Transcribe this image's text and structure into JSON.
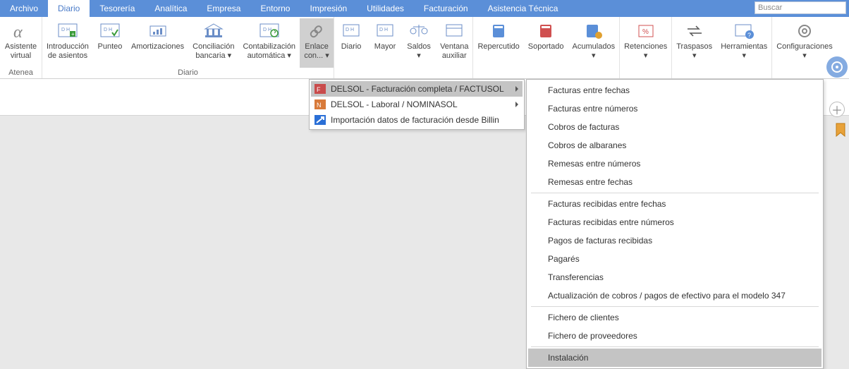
{
  "search_placeholder": "Buscar",
  "tabs": [
    {
      "label": "Archivo"
    },
    {
      "label": "Diario"
    },
    {
      "label": "Tesorería"
    },
    {
      "label": "Analítica"
    },
    {
      "label": "Empresa"
    },
    {
      "label": "Entorno"
    },
    {
      "label": "Impresión"
    },
    {
      "label": "Utilidades"
    },
    {
      "label": "Facturación"
    },
    {
      "label": "Asistencia Técnica"
    }
  ],
  "ribbon": {
    "groups": {
      "atenea": {
        "label": "Atenea",
        "items": {
          "asistente": "Asistente\nvirtual"
        }
      },
      "diario": {
        "label": "Diario",
        "items": {
          "introduccion": "Introducción\nde asientos",
          "punteo": "Punteo",
          "amortizaciones": "Amortizaciones",
          "conciliacion": "Conciliación\nbancaria ▾",
          "contabilizacion": "Contabilización\nautomática ▾",
          "enlace": "Enlace\ncon... ▾"
        }
      },
      "consultas": {
        "diario": "Diario",
        "mayor": "Mayor",
        "saldos": "Saldos\n▾",
        "ventana": "Ventana\nauxiliar"
      },
      "iva": {
        "repercutido": "Repercutido",
        "soportado": "Soportado",
        "acumulados": "Acumulados\n▾"
      },
      "ret": {
        "retenciones": "Retenciones\n▾"
      },
      "utils": {
        "traspasos": "Traspasos\n▾",
        "herramientas": "Herramientas\n▾"
      },
      "config": {
        "configuraciones": "Configuraciones\n▾"
      }
    }
  },
  "submenu1": [
    {
      "label": "DELSOL - Facturación completa / FACTUSOL",
      "icon": "factusol",
      "arrow": true,
      "hovered": true
    },
    {
      "label": "DELSOL - Laboral / NOMINASOL",
      "icon": "nominasol",
      "arrow": true
    },
    {
      "label": "Importación datos de facturación desde Billin",
      "icon": "billin"
    }
  ],
  "submenu2": [
    {
      "label": "Facturas entre fechas"
    },
    {
      "label": "Facturas entre números"
    },
    {
      "label": "Cobros de facturas"
    },
    {
      "label": "Cobros de albaranes"
    },
    {
      "label": "Remesas entre números"
    },
    {
      "label": "Remesas entre fechas"
    },
    {
      "sep": true
    },
    {
      "label": "Facturas recibidas entre fechas"
    },
    {
      "label": "Facturas recibidas entre números"
    },
    {
      "label": "Pagos de facturas recibidas"
    },
    {
      "label": "Pagarés"
    },
    {
      "label": "Transferencias"
    },
    {
      "label": "Actualización de cobros / pagos de efectivo para el modelo 347"
    },
    {
      "sep": true
    },
    {
      "label": "Fichero de clientes"
    },
    {
      "label": "Fichero de proveedores"
    },
    {
      "sep": true
    },
    {
      "label": "Instalación",
      "hovered": true
    }
  ],
  "colors": {
    "accent": "#5b8fd8",
    "menu_hover": "#c4c4c4"
  }
}
